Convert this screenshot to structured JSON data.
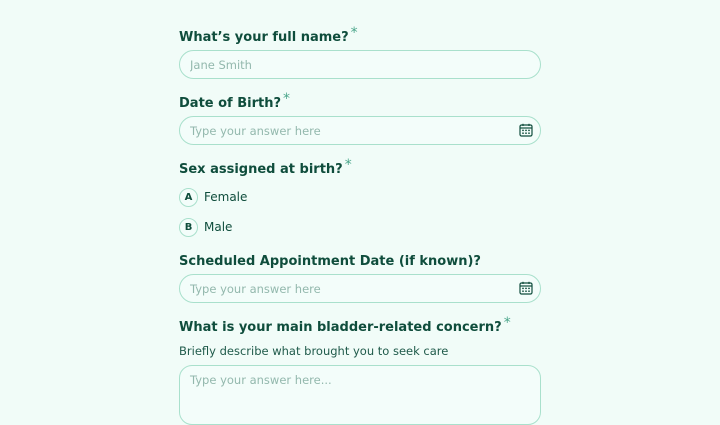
{
  "questions": {
    "full_name": {
      "label": "What’s your full name?",
      "required": "*",
      "placeholder": "Jane Smith"
    },
    "dob": {
      "label": "Date of Birth?",
      "required": "*",
      "placeholder": "Type your answer here",
      "icon": "calendar-icon"
    },
    "sex": {
      "label": "Sex assigned at birth?",
      "required": "*",
      "options": [
        {
          "key": "A",
          "label": "Female"
        },
        {
          "key": "B",
          "label": "Male"
        }
      ]
    },
    "appointment": {
      "label": "Scheduled Appointment Date (if known)?",
      "placeholder": "Type your answer here",
      "icon": "calendar-icon"
    },
    "concern": {
      "label": "What is your main bladder-related concern?",
      "required": "*",
      "helper": "Briefly describe what brought you to seek care",
      "placeholder": "Type your answer here..."
    }
  },
  "colors": {
    "background": "#f1fcf8",
    "text": "#0f4d3c",
    "border": "#a9e0cc",
    "accent": "#4aa58a"
  }
}
